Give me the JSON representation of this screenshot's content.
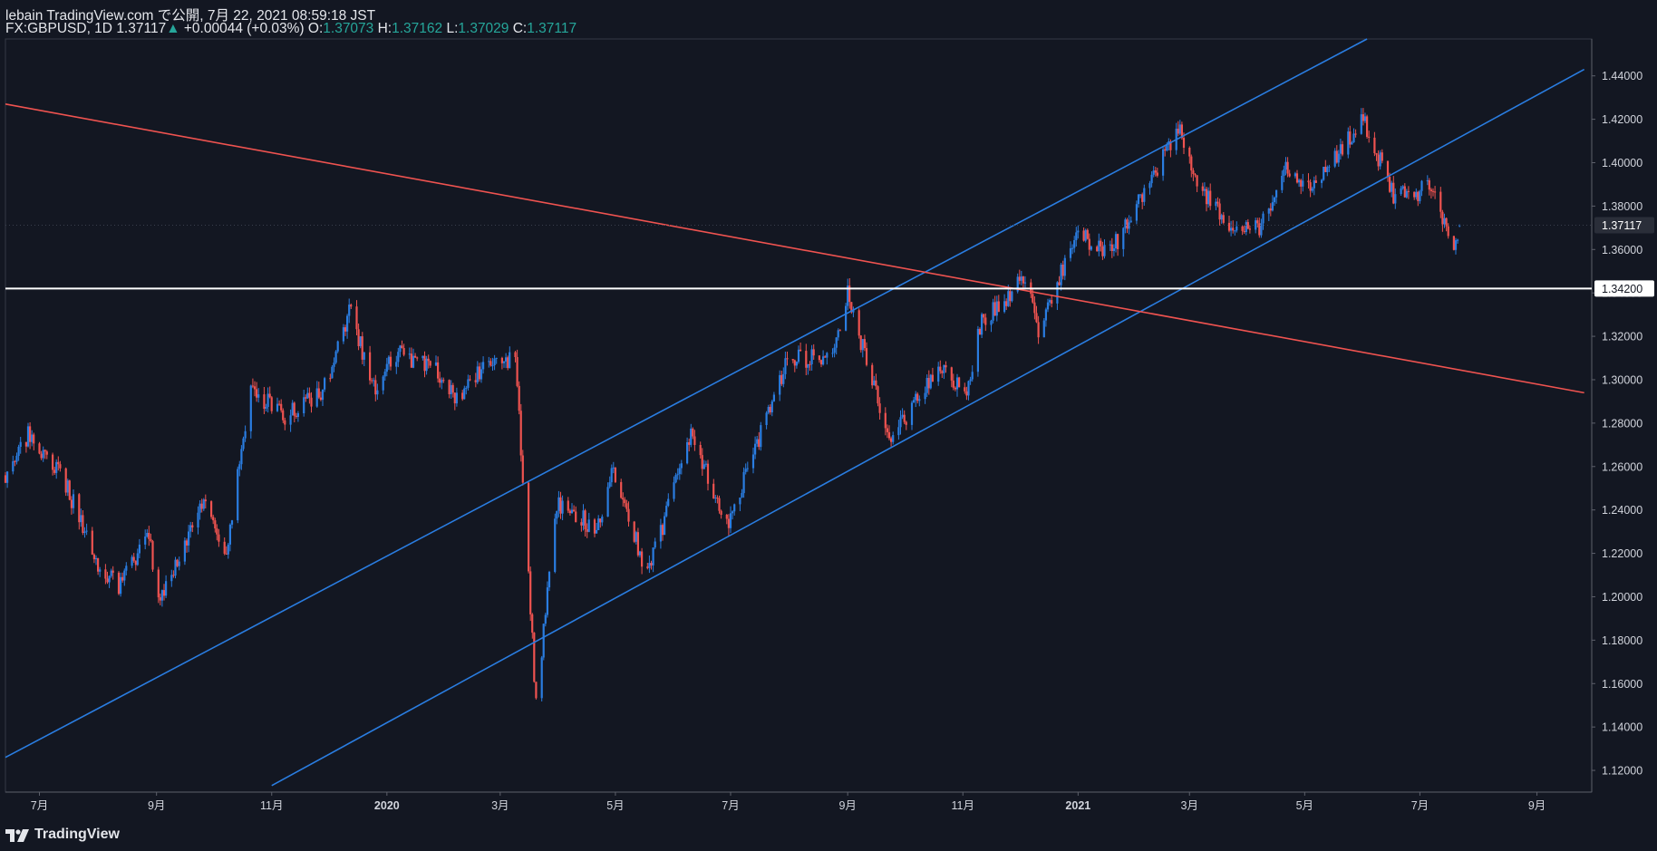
{
  "header": {
    "published": "lebain TradingView.com で公開, 7月 22, 2021 08:59:18 JST",
    "symbol": "FX:GBPUSD, 1D",
    "last": "1.37117",
    "change_arrow": "▲",
    "change": "+0.00044 (+0.03%)",
    "o_label": "O:",
    "o_value": "1.37073",
    "h_label": "H:",
    "h_value": "1.37162",
    "l_label": "L:",
    "l_value": "1.37029",
    "c_label": "C:",
    "c_value": "1.37117"
  },
  "brand": "TradingView",
  "colors": {
    "background": "#131722",
    "up": "#2a7de1",
    "down": "#ef5350",
    "channel": "#2a7de1",
    "trendline": "#ef5350",
    "hline": "#ffffff",
    "axis_text": "#d1d4dc",
    "header_values": "#26a69a"
  },
  "chart_data": {
    "type": "candlestick",
    "symbol": "FX:GBPUSD",
    "interval": "1D",
    "y_axis": {
      "ylim": [
        1.11,
        1.457
      ],
      "ticks": [
        1.12,
        1.14,
        1.16,
        1.18,
        1.2,
        1.22,
        1.24,
        1.26,
        1.28,
        1.3,
        1.32,
        1.34,
        1.36,
        1.38,
        1.4,
        1.42,
        1.44
      ],
      "tick_labels": [
        "1.12000",
        "1.14000",
        "1.16000",
        "1.18000",
        "1.20000",
        "1.22000",
        "1.24000",
        "1.26000",
        "1.28000",
        "1.30000",
        "1.32000",
        "1.34000",
        "1.36000",
        "1.38000",
        "1.40000",
        "1.42000",
        "1.44000"
      ]
    },
    "x_axis": {
      "xlim": [
        "2019-06-13",
        "2021-09-30"
      ],
      "ticks": [
        "2019-07-01",
        "2019-09-01",
        "2019-11-01",
        "2020-01-01",
        "2020-03-01",
        "2020-05-01",
        "2020-07-01",
        "2020-09-01",
        "2020-11-01",
        "2021-01-01",
        "2021-03-01",
        "2021-05-01",
        "2021-07-01",
        "2021-09-01"
      ],
      "tick_labels": [
        "7月",
        "9月",
        "11月",
        "2020",
        "3月",
        "5月",
        "7月",
        "9月",
        "11月",
        "2021",
        "3月",
        "5月",
        "7月",
        "9月"
      ]
    },
    "price_path": [
      [
        "2019-06-13",
        1.256
      ],
      [
        "2019-06-25",
        1.275
      ],
      [
        "2019-07-15",
        1.252
      ],
      [
        "2019-07-31",
        1.216
      ],
      [
        "2019-08-12",
        1.205
      ],
      [
        "2019-08-28",
        1.227
      ],
      [
        "2019-09-03",
        1.197
      ],
      [
        "2019-09-25",
        1.245
      ],
      [
        "2019-10-08",
        1.222
      ],
      [
        "2019-10-21",
        1.296
      ],
      [
        "2019-11-07",
        1.283
      ],
      [
        "2019-11-28",
        1.294
      ],
      [
        "2019-12-13",
        1.333
      ],
      [
        "2019-12-24",
        1.295
      ],
      [
        "2020-01-07",
        1.313
      ],
      [
        "2020-01-31",
        1.302
      ],
      [
        "2020-02-05",
        1.291
      ],
      [
        "2020-02-21",
        1.305
      ],
      [
        "2020-03-09",
        1.311
      ],
      [
        "2020-03-20",
        1.15
      ],
      [
        "2020-03-31",
        1.244
      ],
      [
        "2020-04-21",
        1.231
      ],
      [
        "2020-04-30",
        1.259
      ],
      [
        "2020-05-18",
        1.21
      ],
      [
        "2020-06-10",
        1.275
      ],
      [
        "2020-06-29",
        1.232
      ],
      [
        "2020-07-31",
        1.309
      ],
      [
        "2020-08-24",
        1.311
      ],
      [
        "2020-09-01",
        1.339
      ],
      [
        "2020-09-23",
        1.272
      ],
      [
        "2020-10-21",
        1.307
      ],
      [
        "2020-11-02",
        1.292
      ],
      [
        "2020-11-11",
        1.327
      ],
      [
        "2020-12-04",
        1.347
      ],
      [
        "2020-12-11",
        1.322
      ],
      [
        "2020-12-31",
        1.367
      ],
      [
        "2021-01-18",
        1.358
      ],
      [
        "2021-02-24",
        1.416
      ],
      [
        "2021-03-04",
        1.391
      ],
      [
        "2021-03-23",
        1.372
      ],
      [
        "2021-04-08",
        1.37
      ],
      [
        "2021-04-20",
        1.397
      ],
      [
        "2021-05-06",
        1.39
      ],
      [
        "2021-06-01",
        1.42
      ],
      [
        "2021-06-17",
        1.385
      ],
      [
        "2021-06-28",
        1.385
      ],
      [
        "2021-07-06",
        1.39
      ],
      [
        "2021-07-20",
        1.36
      ],
      [
        "2021-07-22",
        1.371
      ]
    ],
    "last_price": 1.37117,
    "last_price_label": "1.37117",
    "drawings": [
      {
        "type": "trendline",
        "color": "#2a7de1",
        "points": [
          [
            "2019-06-13",
            1.126
          ],
          [
            "2021-06-03",
            1.457
          ]
        ]
      },
      {
        "type": "trendline",
        "color": "#2a7de1",
        "points": [
          [
            "2019-11-01",
            1.113
          ],
          [
            "2021-09-26",
            1.443
          ]
        ]
      },
      {
        "type": "trendline",
        "color": "#ef5350",
        "points": [
          [
            "2019-06-13",
            1.427
          ],
          [
            "2021-09-26",
            1.294
          ]
        ]
      },
      {
        "type": "horizontal_line",
        "color": "#ffffff",
        "price": 1.342,
        "label": "1.34200"
      }
    ],
    "grid": false,
    "legend": "none"
  }
}
